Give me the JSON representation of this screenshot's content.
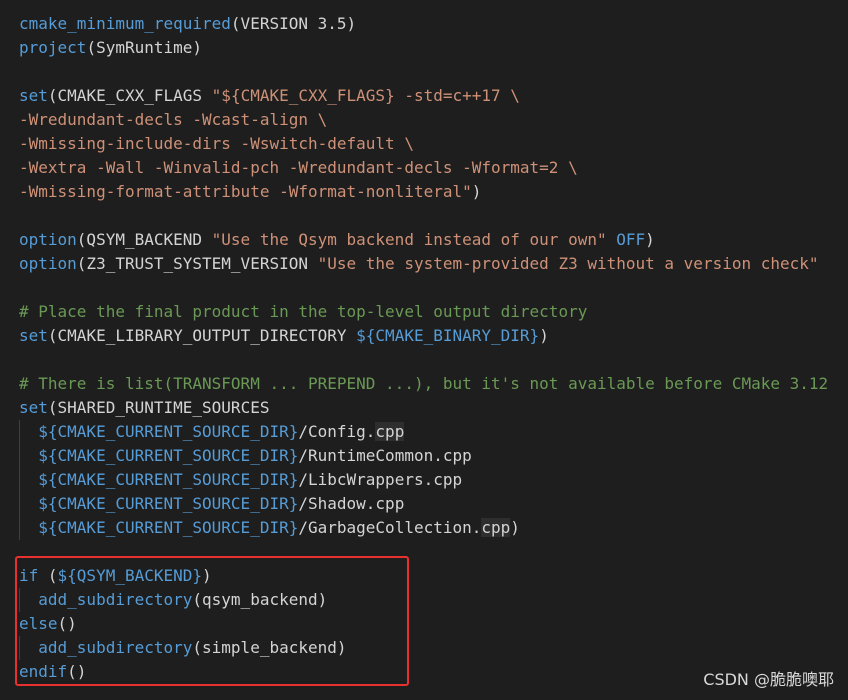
{
  "editor": {
    "lines": [
      [
        {
          "t": "cmake_minimum_required",
          "c": "cmd"
        },
        {
          "t": "(VERSION 3.5)",
          "c": "plain"
        }
      ],
      [
        {
          "t": "project",
          "c": "cmd"
        },
        {
          "t": "(SymRuntime)",
          "c": "plain"
        }
      ],
      [],
      [
        {
          "t": "set",
          "c": "cmd"
        },
        {
          "t": "(CMAKE_CXX_FLAGS ",
          "c": "plain"
        },
        {
          "t": "\"${CMAKE_CXX_FLAGS} -std=c++17 \\",
          "c": "str"
        }
      ],
      [
        {
          "t": "-Wredundant-decls -Wcast-align \\",
          "c": "str"
        }
      ],
      [
        {
          "t": "-Wmissing-include-dirs -Wswitch-default \\",
          "c": "str"
        }
      ],
      [
        {
          "t": "-Wextra -Wall -Winvalid-pch -Wredundant-decls -Wformat=2 \\",
          "c": "str"
        }
      ],
      [
        {
          "t": "-Wmissing-format-attribute -Wformat-nonliteral\"",
          "c": "str"
        },
        {
          "t": ")",
          "c": "plain"
        }
      ],
      [],
      [
        {
          "t": "option",
          "c": "cmd"
        },
        {
          "t": "(QSYM_BACKEND ",
          "c": "plain"
        },
        {
          "t": "\"Use the Qsym backend instead of our own\"",
          "c": "str"
        },
        {
          "t": " ",
          "c": "plain"
        },
        {
          "t": "OFF",
          "c": "var"
        },
        {
          "t": ")",
          "c": "plain"
        }
      ],
      [
        {
          "t": "option",
          "c": "cmd"
        },
        {
          "t": "(Z3_TRUST_SYSTEM_VERSION ",
          "c": "plain"
        },
        {
          "t": "\"Use the system-provided Z3 without a version check\"",
          "c": "str"
        }
      ],
      [],
      [
        {
          "t": "# Place the final product in the top-level output directory",
          "c": "com"
        }
      ],
      [
        {
          "t": "set",
          "c": "cmd"
        },
        {
          "t": "(CMAKE_LIBRARY_OUTPUT_DIRECTORY ",
          "c": "plain"
        },
        {
          "t": "${CMAKE_BINARY_DIR}",
          "c": "var"
        },
        {
          "t": ")",
          "c": "plain"
        }
      ],
      [],
      [
        {
          "t": "# There is list(TRANSFORM ... PREPEND ...), but it's not available before CMake 3.12",
          "c": "com"
        }
      ],
      [
        {
          "t": "set",
          "c": "cmd"
        },
        {
          "t": "(SHARED_RUNTIME_SOURCES",
          "c": "plain"
        }
      ],
      [
        {
          "t": "  ",
          "c": "plain"
        },
        {
          "t": "${CMAKE_CURRENT_SOURCE_DIR}",
          "c": "var"
        },
        {
          "t": "/Config.",
          "c": "plain"
        },
        {
          "t": "cpp",
          "c": "ext"
        }
      ],
      [
        {
          "t": "  ",
          "c": "plain"
        },
        {
          "t": "${CMAKE_CURRENT_SOURCE_DIR}",
          "c": "var"
        },
        {
          "t": "/RuntimeCommon.cpp",
          "c": "plain"
        }
      ],
      [
        {
          "t": "  ",
          "c": "plain"
        },
        {
          "t": "${CMAKE_CURRENT_SOURCE_DIR}",
          "c": "var"
        },
        {
          "t": "/LibcWrappers.cpp",
          "c": "plain"
        }
      ],
      [
        {
          "t": "  ",
          "c": "plain"
        },
        {
          "t": "${CMAKE_CURRENT_SOURCE_DIR}",
          "c": "var"
        },
        {
          "t": "/Shadow.cpp",
          "c": "plain"
        }
      ],
      [
        {
          "t": "  ",
          "c": "plain"
        },
        {
          "t": "${CMAKE_CURRENT_SOURCE_DIR}",
          "c": "var"
        },
        {
          "t": "/GarbageCollection.",
          "c": "plain"
        },
        {
          "t": "cpp",
          "c": "ext"
        },
        {
          "t": ")",
          "c": "plain"
        }
      ],
      [],
      [
        {
          "t": "if",
          "c": "cmd"
        },
        {
          "t": " (",
          "c": "plain"
        },
        {
          "t": "${QSYM_BACKEND}",
          "c": "var"
        },
        {
          "t": ")",
          "c": "plain"
        }
      ],
      [
        {
          "t": "  ",
          "c": "plain"
        },
        {
          "t": "add_subdirectory",
          "c": "cmd"
        },
        {
          "t": "(qsym_backend)",
          "c": "plain"
        }
      ],
      [
        {
          "t": "else",
          "c": "cmd"
        },
        {
          "t": "()",
          "c": "plain"
        }
      ],
      [
        {
          "t": "  ",
          "c": "plain"
        },
        {
          "t": "add_subdirectory",
          "c": "cmd"
        },
        {
          "t": "(simple_backend)",
          "c": "plain"
        }
      ],
      [
        {
          "t": "endif",
          "c": "cmd"
        },
        {
          "t": "()",
          "c": "plain"
        }
      ]
    ]
  },
  "watermark": "CSDN @脆脆噢耶",
  "colors": {
    "background": "#1e1e1e",
    "command": "#569cd6",
    "string": "#ce9178",
    "comment": "#6a9955",
    "text": "#d4d4d4",
    "highlight_border": "#e8312f"
  }
}
